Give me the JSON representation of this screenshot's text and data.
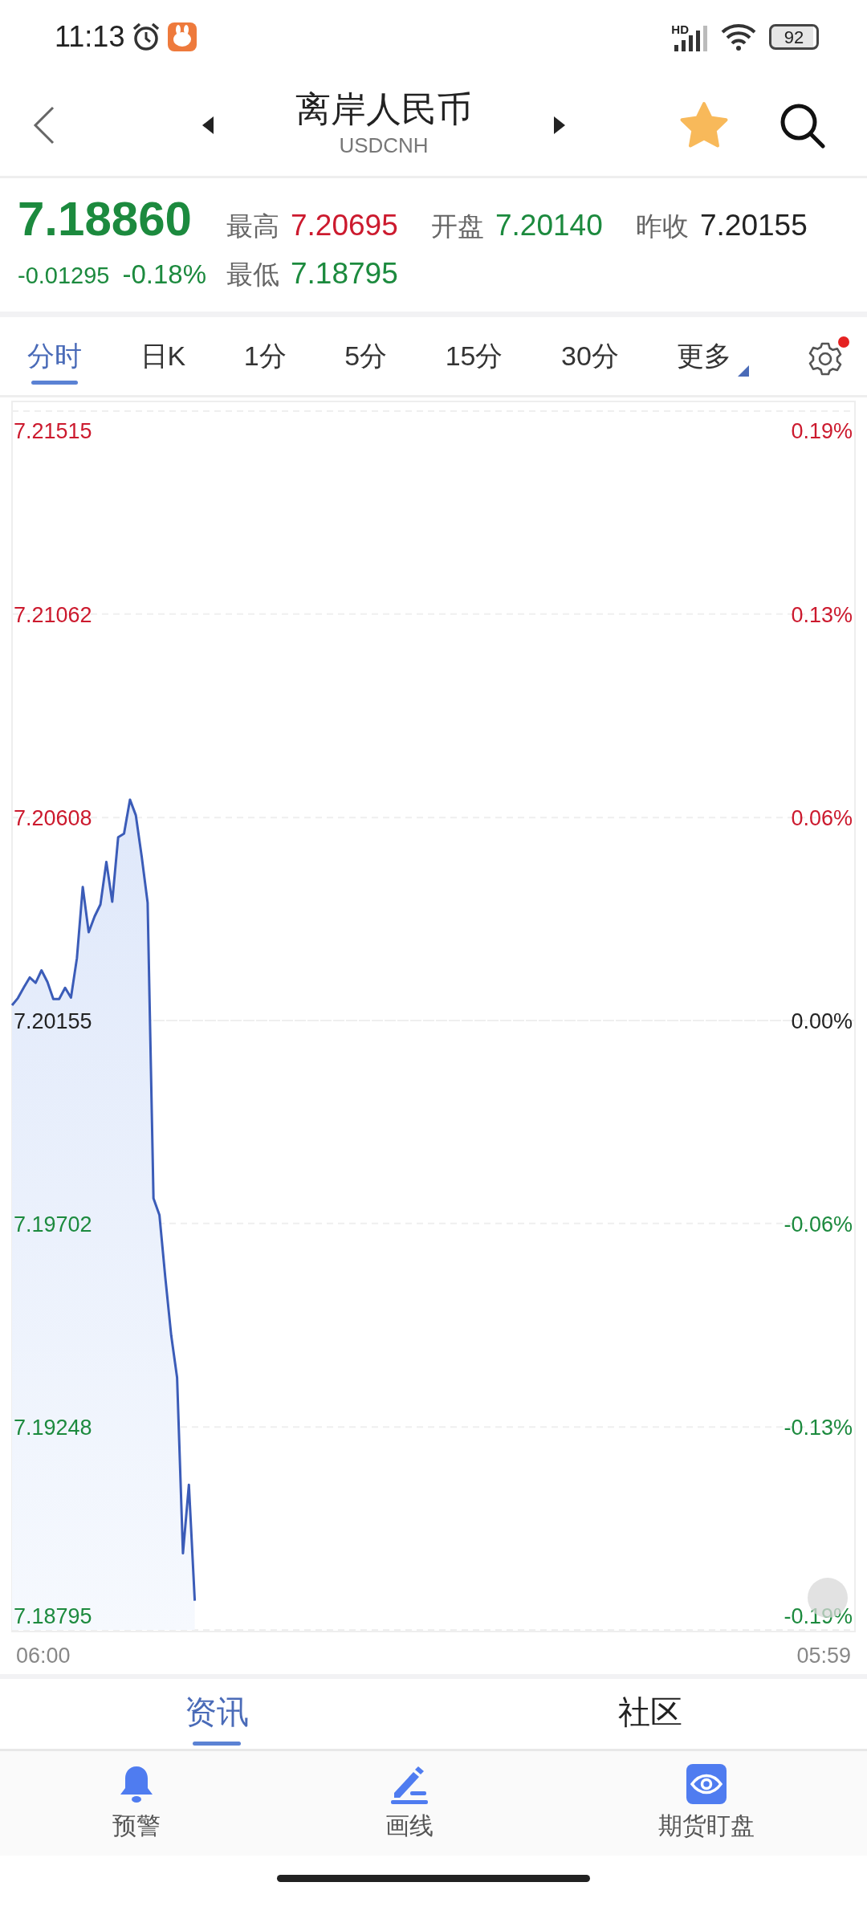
{
  "status_bar": {
    "time": "11:13",
    "network": "HD",
    "battery": "92"
  },
  "header": {
    "title": "离岸人民币",
    "subtitle": "USDCNH",
    "favorite": true
  },
  "quote": {
    "price": "7.18860",
    "change": "-0.01295",
    "change_percent": "-0.18%"
  },
  "stats": [
    {
      "kind": "high",
      "label": "最高",
      "value": "7.20695"
    },
    {
      "kind": "open",
      "label": "开盘",
      "value": "7.20140"
    },
    {
      "kind": "prev_close",
      "label": "昨收",
      "value": "7.20155"
    },
    {
      "kind": "low",
      "label": "最低",
      "value": "7.18795"
    }
  ],
  "periods": [
    {
      "kind": "period",
      "label": "分时",
      "selected": true
    },
    {
      "kind": "period",
      "label": "日K",
      "selected": false
    },
    {
      "kind": "period",
      "label": "1分",
      "selected": false
    },
    {
      "kind": "period",
      "label": "5分",
      "selected": false
    },
    {
      "kind": "period",
      "label": "15分",
      "selected": false
    },
    {
      "kind": "period",
      "label": "30分",
      "selected": false
    },
    {
      "kind": "menu",
      "label": "更多",
      "selected": false
    }
  ],
  "settings": {
    "badge": true
  },
  "chart": {
    "chart_data": {
      "type": "area",
      "grid": true,
      "categories": [
        null,
        null,
        null,
        null,
        null,
        null,
        null,
        null,
        null,
        null,
        null,
        null,
        null,
        null,
        null,
        null,
        null,
        null,
        null,
        null,
        null,
        null,
        null,
        null,
        null,
        null,
        null,
        null,
        null,
        null,
        null,
        null,
        null,
        null,
        null,
        null,
        null,
        null,
        null,
        null,
        null,
        null,
        null,
        null,
        null,
        null,
        null,
        null,
        null,
        null,
        null,
        null,
        null,
        null,
        null,
        null,
        null,
        null,
        null,
        null,
        null,
        null,
        null,
        null,
        null,
        null,
        null,
        null,
        null,
        null,
        null,
        null,
        null,
        null,
        null,
        null,
        null,
        null,
        null,
        null,
        null,
        null,
        null,
        null,
        null,
        null,
        null,
        null,
        null,
        null,
        null,
        null,
        null,
        null,
        null,
        null,
        null,
        null,
        null,
        null,
        null,
        null,
        null,
        null,
        null,
        null,
        null,
        null,
        null,
        null,
        null,
        null,
        null,
        null,
        null,
        null,
        null,
        null,
        null,
        null,
        null,
        null,
        null,
        null,
        null,
        null,
        null,
        null,
        null,
        null,
        null,
        null,
        null,
        null,
        null,
        null,
        null,
        null,
        null,
        null,
        null,
        null,
        null,
        null
      ],
      "series": [
        {
          "color": "#3b5cb8",
          "values": [
            7.20189,
            7.20205,
            7.20229,
            7.20251,
            7.20239,
            7.20267,
            7.20241,
            7.20203,
            7.20203,
            7.20228,
            7.20206,
            7.20294,
            7.20453,
            7.20352,
            7.20387,
            7.20414,
            7.20509,
            7.2042,
            7.20564,
            7.20572,
            7.20648,
            7.20613,
            7.20521,
            7.20418,
            7.19758,
            7.19721,
            7.19582,
            7.19452,
            7.19358,
            7.18966,
            7.19119,
            7.1886,
            null,
            null,
            null,
            null,
            null,
            null,
            null,
            null,
            null,
            null,
            null,
            null,
            null,
            null,
            null,
            null,
            null,
            null,
            null,
            null,
            null,
            null,
            null,
            null,
            null,
            null,
            null,
            null,
            null,
            null,
            null,
            null,
            null,
            null,
            null,
            null,
            null,
            null,
            null,
            null,
            null,
            null,
            null,
            null,
            null,
            null,
            null,
            null,
            null,
            null,
            null,
            null,
            null,
            null,
            null,
            null,
            null,
            null,
            null,
            null,
            null,
            null,
            null,
            null,
            null,
            null,
            null,
            null,
            null,
            null,
            null,
            null,
            null,
            null,
            null,
            null,
            null,
            null,
            null,
            null,
            null,
            null,
            null,
            null,
            null,
            null,
            null,
            null,
            null,
            null,
            null,
            null,
            null,
            null,
            null,
            null,
            null,
            null,
            null,
            null,
            null,
            null,
            null,
            null,
            null,
            null,
            null,
            null,
            null,
            null,
            null,
            null
          ]
        }
      ],
      "ylim": [
        7.18795,
        7.21515
      ],
      "yticks": [
        {
          "value": 7.21515,
          "label": "7.21515"
        },
        {
          "value": 7.21062,
          "label": "7.21062"
        },
        {
          "value": 7.20608,
          "label": "7.20608"
        },
        {
          "value": 7.20155,
          "label": "7.20155"
        },
        {
          "value": 7.19702,
          "label": "7.19702"
        },
        {
          "value": 7.19248,
          "label": "7.19248"
        },
        {
          "value": 7.18795,
          "label": "7.18795"
        }
      ]
    },
    "time_labels": [
      "06:00",
      "05:59"
    ],
    "percent_labels": [
      "0.19%",
      "0.13%",
      "0.06%",
      "0.00%",
      "-0.06%",
      "-0.13%",
      "-0.19%"
    ]
  },
  "content_tabs": [
    {
      "label": "资讯",
      "selected": true
    },
    {
      "label": "社区",
      "selected": false
    }
  ],
  "toolbar": [
    {
      "label": "预警"
    },
    {
      "label": "画线"
    },
    {
      "label": "期货盯盘"
    }
  ]
}
